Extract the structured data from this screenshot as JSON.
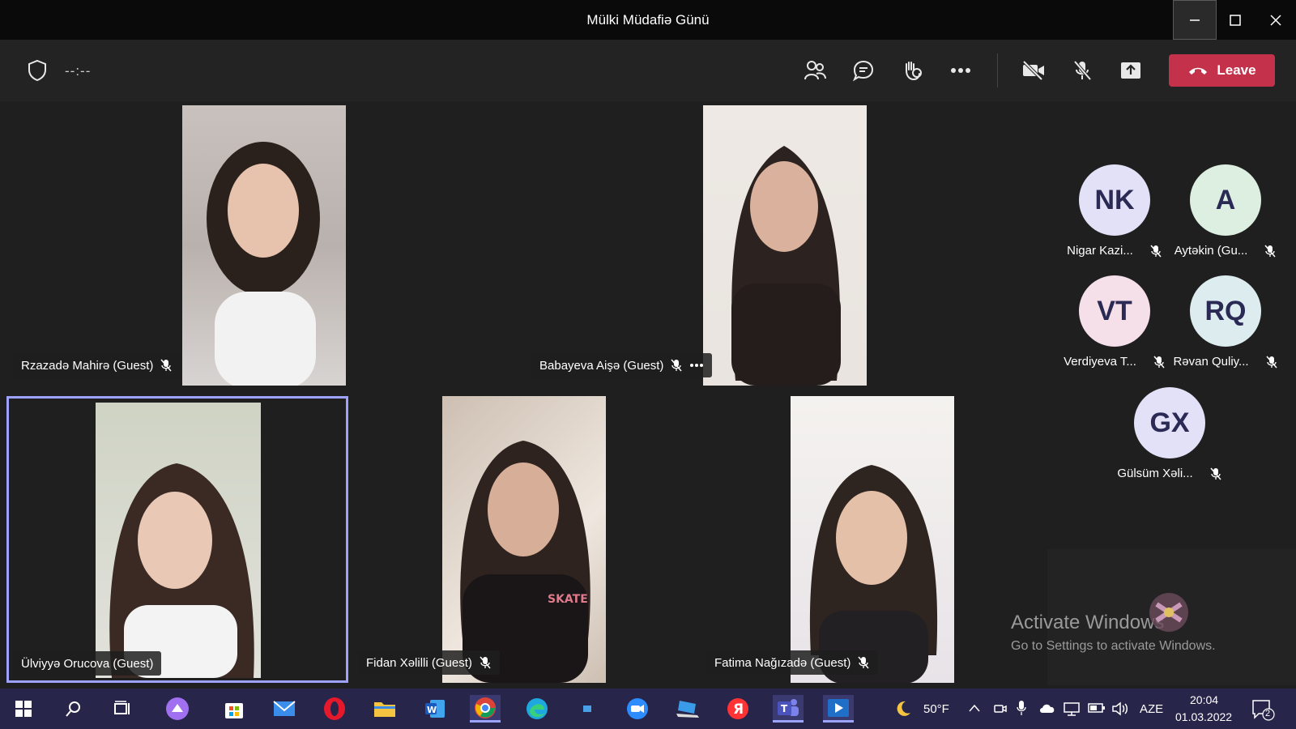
{
  "window": {
    "title": "Mülki Müdafiə Günü"
  },
  "toolbar": {
    "timer": "--:--",
    "leave_label": "Leave"
  },
  "tiles": [
    {
      "name": "Rzazadə Mahirə (Guest)"
    },
    {
      "name": "Babayeva Aişə (Guest)"
    },
    {
      "name": "Ülviyyə Orucova (Guest)"
    },
    {
      "name": "Fidan Xəlilli (Guest)"
    },
    {
      "name": "Fatima Nağızadə (Guest)"
    }
  ],
  "roster": [
    {
      "initials": "NK",
      "name": "Nigar Kazi...",
      "color": "#e3e1f7"
    },
    {
      "initials": "A",
      "name": "Aytəkin (Gu...",
      "color": "#dcefe0"
    },
    {
      "initials": "VT",
      "name": "Verdiyeva T...",
      "color": "#f5dfe9"
    },
    {
      "initials": "RQ",
      "name": "Rəvan Quliy...",
      "color": "#dcecef"
    },
    {
      "initials": "GX",
      "name": "Gülsüm Xəli...",
      "color": "#e3e1f7"
    }
  ],
  "watermark": {
    "line1": "Activate Windows",
    "line2": "Go to Settings to activate Windows."
  },
  "taskbar": {
    "weather": "50°F",
    "language": "AZE",
    "time": "20:04",
    "date": "01.03.2022",
    "notifications": "2"
  },
  "colors": {
    "accent": "#9ea2ff",
    "leave": "#c4314b",
    "taskbar": "#27264a"
  }
}
